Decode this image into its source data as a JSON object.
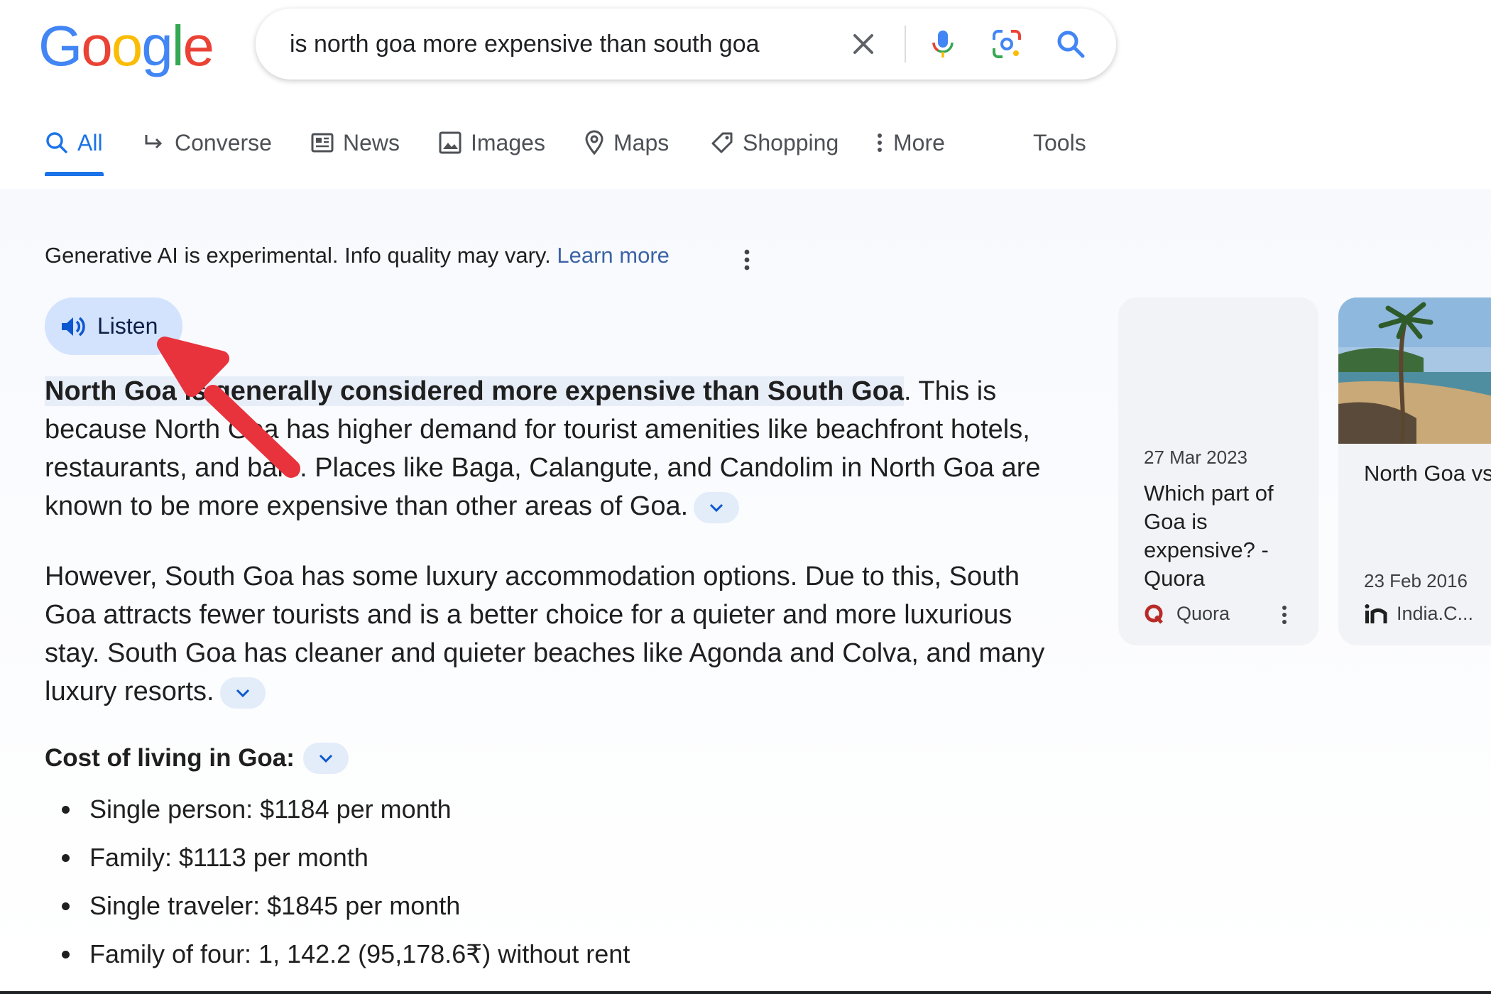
{
  "logo": {
    "letters": [
      "G",
      "o",
      "o",
      "g",
      "l",
      "e"
    ],
    "colors": [
      "#4285f4",
      "#ea4335",
      "#fbbc05",
      "#4285f4",
      "#34a853",
      "#ea4335"
    ]
  },
  "search": {
    "query": "is north goa more expensive than south goa"
  },
  "tabs": [
    {
      "label": "All",
      "icon": "search-icon",
      "active": true
    },
    {
      "label": "Converse",
      "icon": "reply-arrow-icon"
    },
    {
      "label": "News",
      "icon": "news-icon"
    },
    {
      "label": "Images",
      "icon": "image-icon"
    },
    {
      "label": "Maps",
      "icon": "map-pin-icon"
    },
    {
      "label": "Shopping",
      "icon": "tag-icon"
    },
    {
      "label": "More",
      "icon": "more-vertical-icon"
    },
    {
      "label": "Tools"
    }
  ],
  "ai": {
    "notice": "Generative AI is experimental. Info quality may vary.",
    "learn_more": "Learn more",
    "listen": "Listen",
    "p1_highlight": "North Goa is generally considered more expensive than South Goa",
    "p1_rest": ". This is because North Goa has higher demand for tourist amenities like beachfront hotels, restaurants, and bars. Places like Baga, Calangute, and Candolim in North Goa are known to be more expensive than other areas of Goa.",
    "p2": "However, South Goa has some luxury accommodation options. Due to this, South Goa attracts fewer tourists and is a better choice for a quieter and more luxurious stay. South Goa has cleaner and quieter beaches like Agonda and Colva, and many luxury resorts.",
    "cost_heading": "Cost of living in Goa:",
    "cost_items": [
      "Single person: $1184 per month",
      "Family: $1113 per month",
      "Single traveler: $1845 per month",
      "Family of four: 1, 142.2 (95,178.6₹) without rent"
    ]
  },
  "cards": [
    {
      "date": "27 Mar 2023",
      "title": "Which part of Goa is expensive? - Quora",
      "source": "Quora"
    },
    {
      "date": "23 Feb 2016",
      "title": "North Goa vs South Goa: Where shoul",
      "source": "India.C..."
    }
  ],
  "colors": {
    "accent": "#1a73e8",
    "listen_bg": "#d3e3fd",
    "highlight": "#e8eef8",
    "arrow": "#e8323c"
  }
}
